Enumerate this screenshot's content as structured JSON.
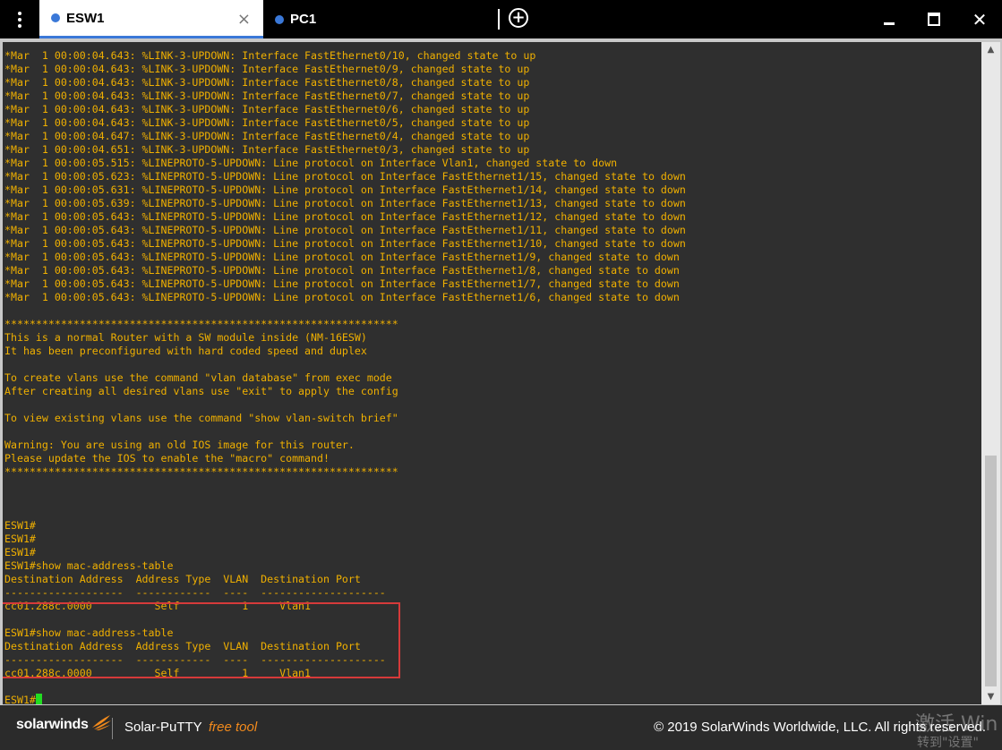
{
  "tabs": [
    {
      "label": "ESW1",
      "close": "×"
    },
    {
      "label": "PC1"
    }
  ],
  "newtab_symbol": "+",
  "window_controls": {
    "close": "✕"
  },
  "terminal": {
    "lines": [
      "*Mar  1 00:00:04.643: %LINK-3-UPDOWN: Interface FastEthernet0/10, changed state to up",
      "*Mar  1 00:00:04.643: %LINK-3-UPDOWN: Interface FastEthernet0/9, changed state to up",
      "*Mar  1 00:00:04.643: %LINK-3-UPDOWN: Interface FastEthernet0/8, changed state to up",
      "*Mar  1 00:00:04.643: %LINK-3-UPDOWN: Interface FastEthernet0/7, changed state to up",
      "*Mar  1 00:00:04.643: %LINK-3-UPDOWN: Interface FastEthernet0/6, changed state to up",
      "*Mar  1 00:00:04.643: %LINK-3-UPDOWN: Interface FastEthernet0/5, changed state to up",
      "*Mar  1 00:00:04.647: %LINK-3-UPDOWN: Interface FastEthernet0/4, changed state to up",
      "*Mar  1 00:00:04.651: %LINK-3-UPDOWN: Interface FastEthernet0/3, changed state to up",
      "*Mar  1 00:00:05.515: %LINEPROTO-5-UPDOWN: Line protocol on Interface Vlan1, changed state to down",
      "*Mar  1 00:00:05.623: %LINEPROTO-5-UPDOWN: Line protocol on Interface FastEthernet1/15, changed state to down",
      "*Mar  1 00:00:05.631: %LINEPROTO-5-UPDOWN: Line protocol on Interface FastEthernet1/14, changed state to down",
      "*Mar  1 00:00:05.639: %LINEPROTO-5-UPDOWN: Line protocol on Interface FastEthernet1/13, changed state to down",
      "*Mar  1 00:00:05.643: %LINEPROTO-5-UPDOWN: Line protocol on Interface FastEthernet1/12, changed state to down",
      "*Mar  1 00:00:05.643: %LINEPROTO-5-UPDOWN: Line protocol on Interface FastEthernet1/11, changed state to down",
      "*Mar  1 00:00:05.643: %LINEPROTO-5-UPDOWN: Line protocol on Interface FastEthernet1/10, changed state to down",
      "*Mar  1 00:00:05.643: %LINEPROTO-5-UPDOWN: Line protocol on Interface FastEthernet1/9, changed state to down",
      "*Mar  1 00:00:05.643: %LINEPROTO-5-UPDOWN: Line protocol on Interface FastEthernet1/8, changed state to down",
      "*Mar  1 00:00:05.643: %LINEPROTO-5-UPDOWN: Line protocol on Interface FastEthernet1/7, changed state to down",
      "*Mar  1 00:00:05.643: %LINEPROTO-5-UPDOWN: Line protocol on Interface FastEthernet1/6, changed state to down",
      "",
      "***************************************************************",
      "This is a normal Router with a SW module inside (NM-16ESW)",
      "It has been preconfigured with hard coded speed and duplex",
      "",
      "To create vlans use the command \"vlan database\" from exec mode",
      "After creating all desired vlans use \"exit\" to apply the config",
      "",
      "To view existing vlans use the command \"show vlan-switch brief\"",
      "",
      "Warning: You are using an old IOS image for this router.",
      "Please update the IOS to enable the \"macro\" command!",
      "***************************************************************",
      "",
      "",
      "",
      "ESW1#",
      "ESW1#",
      "ESW1#",
      "ESW1#show mac-address-table",
      "Destination Address  Address Type  VLAN  Destination Port",
      "-------------------  ------------  ----  --------------------",
      "cc01.288c.0000          Self          1     Vlan1",
      "",
      "ESW1#show mac-address-table",
      "Destination Address  Address Type  VLAN  Destination Port",
      "-------------------  ------------  ----  --------------------",
      "cc01.288c.0000          Self          1     Vlan1",
      "",
      "ESW1#"
    ]
  },
  "footer": {
    "brand": "solarwinds",
    "product": "Solar-PuTTY",
    "free_tool": "free tool",
    "copyright": "© 2019 SolarWinds Worldwide, LLC. All rights reserved.",
    "watermark_line1": "激活 Win",
    "watermark_line2": "转到\"设置\""
  },
  "colors": {
    "terminal_text": "#f0b000",
    "terminal_bg": "#2f2f2f",
    "cursor": "#22dd22",
    "tab_accent": "#3a78d8",
    "highlight": "#d63a3a",
    "free_tool": "#f28a1c"
  }
}
